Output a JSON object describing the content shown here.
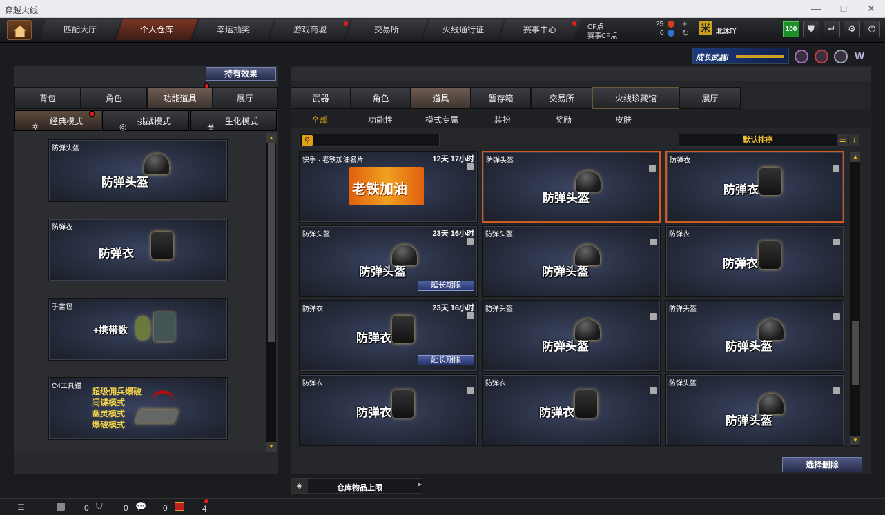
{
  "window": {
    "title": "穿越火线"
  },
  "nav": {
    "home_icon": "home-icon",
    "tabs": [
      {
        "label": "匹配大厅",
        "active": false
      },
      {
        "label": "个人仓库",
        "active": true
      },
      {
        "label": "幸运抽奖",
        "active": false
      },
      {
        "label": "游戏商城",
        "active": false,
        "badge": true
      },
      {
        "label": "交易所",
        "active": false
      },
      {
        "label": "火线通行证",
        "active": false
      },
      {
        "label": "赛事中心",
        "active": false,
        "badge": true
      }
    ],
    "cf_label": "CF点",
    "cf_value": "25",
    "match_cf_label": "赛事CF点",
    "match_cf_value": "0",
    "rank_icon_text": "米",
    "username": "北沐吖",
    "level": "100"
  },
  "banner": {
    "text": "成长武器!"
  },
  "left": {
    "hold_effect": "持有效果",
    "tabs": [
      "背包",
      "角色",
      "功能道具",
      "展厅"
    ],
    "selected_tab": "功能道具",
    "modes": [
      "经典模式",
      "挑战模式",
      "生化模式"
    ],
    "selected_mode": "经典模式",
    "cards": [
      {
        "name": "防弹头盔",
        "title": "防弹头盔"
      },
      {
        "name": "防弹衣",
        "title": "防弹衣"
      },
      {
        "name": "手雷包",
        "title": "+携带数"
      },
      {
        "name": "C4工具钳",
        "lines": [
          "超级佣兵爆破",
          "间谍模式",
          "幽灵模式",
          "爆破模式"
        ]
      }
    ]
  },
  "right": {
    "tabs": [
      "武器",
      "角色",
      "道具",
      "暂存箱",
      "交易所",
      "火线珍藏馆",
      "展厅"
    ],
    "selected_tab": "道具",
    "subtabs": [
      "全部",
      "功能性",
      "模式专属",
      "装扮",
      "奖励",
      "皮肤"
    ],
    "selected_subtab": "全部",
    "search_placeholder": "",
    "sort_label": "默认排序",
    "grid": [
      {
        "name": "快手 · 老铁加油名片",
        "timer": "12天 17小时",
        "image_text": "老铁加油"
      },
      {
        "name": "防弹头盔",
        "title": "防弹头盔",
        "selected": true
      },
      {
        "name": "防弹衣",
        "title": "防弹衣",
        "selected": true
      },
      {
        "name": "防弹头盔",
        "title": "防弹头盔",
        "timer": "23天 16小时",
        "extend": "延长期限"
      },
      {
        "name": "防弹头盔",
        "title": "防弹头盔"
      },
      {
        "name": "防弹衣",
        "title": "防弹衣"
      },
      {
        "name": "防弹衣",
        "title": "防弹衣",
        "timer": "23天 16小时",
        "extend": "延长期限"
      },
      {
        "name": "防弹头盔",
        "title": "防弹头盔"
      },
      {
        "name": "防弹头盔",
        "title": "防弹头盔"
      },
      {
        "name": "防弹衣",
        "title": "防弹衣"
      },
      {
        "name": "防弹衣",
        "title": "防弹衣"
      },
      {
        "name": "防弹头盔",
        "title": "防弹头盔"
      }
    ],
    "select_delete": "选择删除",
    "warehouse_limit": "仓库物品上限"
  },
  "status": {
    "values": [
      "0",
      "0",
      "0",
      "4"
    ]
  }
}
